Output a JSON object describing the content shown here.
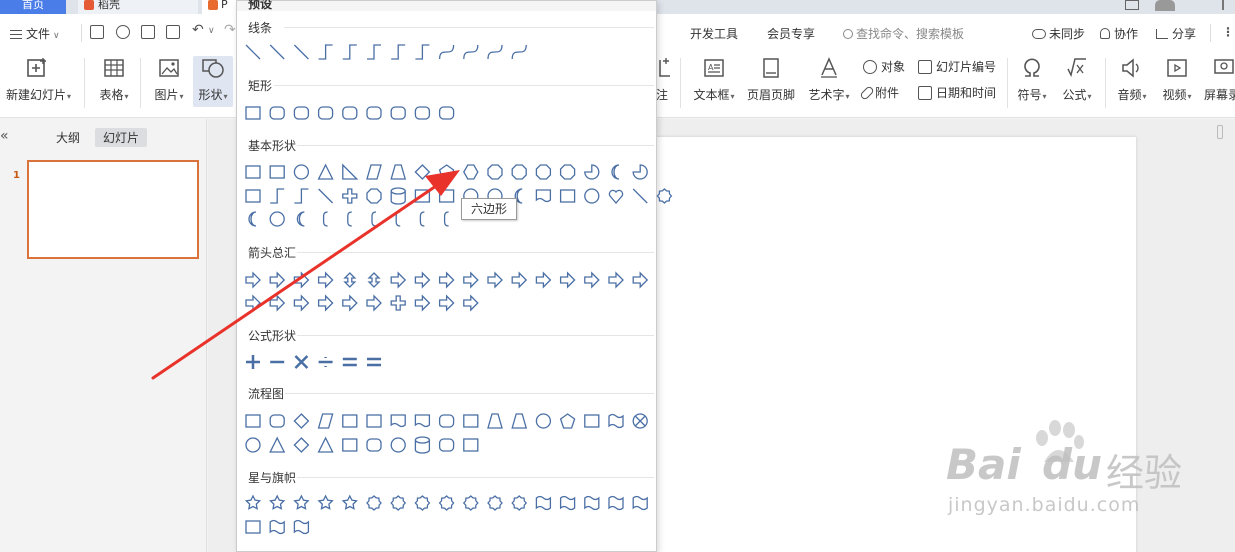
{
  "tabs": {
    "home": "首页",
    "doc": "稻壳",
    "ppt": "P"
  },
  "menubar": {
    "file": "文件",
    "items": [
      "开发工具",
      "会员专享"
    ],
    "search_placeholder": "查找命令、搜索模板",
    "sync": "未同步",
    "collab": "协作",
    "share": "分享"
  },
  "ribbon": {
    "new_slide": "新建幻灯片",
    "table": "表格",
    "image": "图片",
    "shape": "形状",
    "note_suffix": "注",
    "textbox": "文本框",
    "header_footer": "页眉页脚",
    "wordart": "艺术字",
    "object": "对象",
    "attachment": "附件",
    "slide_number": "幻灯片编号",
    "datetime": "日期和时间",
    "symbol": "符号",
    "formula": "公式",
    "audio": "音频",
    "video": "视频",
    "screen": "屏幕录"
  },
  "left_panel": {
    "outline_tab": "大纲",
    "slides_tab": "幻灯片",
    "slide_number": "1",
    "collapse": "«"
  },
  "shape_panel": {
    "top_label": "预设",
    "sections": [
      "线条",
      "矩形",
      "基本形状",
      "箭头总汇",
      "公式形状",
      "流程图",
      "星与旗帜"
    ]
  },
  "tooltip": "六边形",
  "watermark": {
    "brand_latin": "Bai",
    "brand_latin2": "du",
    "brand_cn": "经验",
    "url": "jingyan.baidu.com"
  },
  "colors": {
    "accent": "#4a7de8",
    "arrow": "#e8322a",
    "selected_border": "#d9733b",
    "icon": "#4a6fa5"
  }
}
